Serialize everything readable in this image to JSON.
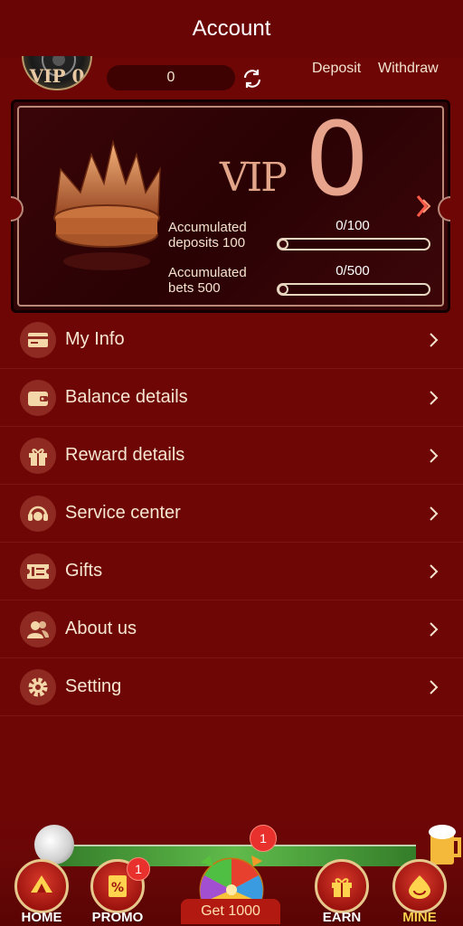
{
  "header": {
    "title": "Account"
  },
  "topbar": {
    "vip_badge": "VIP 0",
    "balance": "0",
    "deposit_label": "Deposit",
    "withdraw_label": "Withdraw"
  },
  "vip_card": {
    "vip_word": "VIP",
    "level": "0",
    "deposits": {
      "label_line1": "Accumulated",
      "label_line2": "deposits 100",
      "value": "0/100",
      "progress": 0
    },
    "bets": {
      "label_line1": "Accumulated",
      "label_line2": "bets 500",
      "value": "0/500",
      "progress": 0
    }
  },
  "menu": {
    "items": [
      {
        "label": "My Info",
        "icon": "card-icon"
      },
      {
        "label": "Balance details",
        "icon": "wallet-icon"
      },
      {
        "label": "Reward details",
        "icon": "gift-box-icon"
      },
      {
        "label": "Service center",
        "icon": "headset-icon"
      },
      {
        "label": "Gifts",
        "icon": "ticket-icon"
      },
      {
        "label": "About us",
        "icon": "people-icon"
      },
      {
        "label": "Setting",
        "icon": "gear-icon"
      }
    ]
  },
  "nav": {
    "home_label": "HOME",
    "promo_label": "PROMO",
    "promo_badge": "1",
    "get_label": "Get 1000",
    "get_badge": "1",
    "earn_label": "EARN",
    "mine_label": "MINE"
  },
  "colors": {
    "background": "#6e0606",
    "accent_gold": "#ffd34d",
    "vip_text": "#e7a38b",
    "badge_red": "#e8302c"
  }
}
